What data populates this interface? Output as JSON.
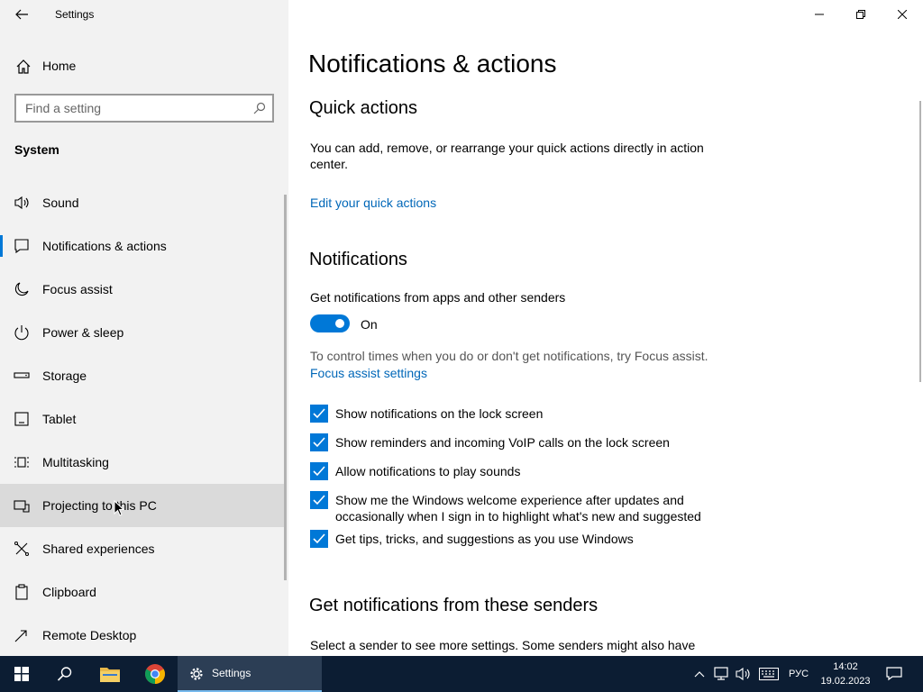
{
  "window": {
    "title": "Settings",
    "controls": [
      "minimize",
      "restore",
      "close"
    ]
  },
  "sidebar": {
    "home_label": "Home",
    "search_placeholder": "Find a setting",
    "section_label": "System",
    "items": [
      {
        "label": "Sound",
        "icon": "speaker-icon",
        "active": false
      },
      {
        "label": "Notifications & actions",
        "icon": "notification-icon",
        "active": true
      },
      {
        "label": "Focus assist",
        "icon": "moon-icon",
        "active": false
      },
      {
        "label": "Power & sleep",
        "icon": "power-icon",
        "active": false
      },
      {
        "label": "Storage",
        "icon": "storage-icon",
        "active": false
      },
      {
        "label": "Tablet",
        "icon": "tablet-icon",
        "active": false
      },
      {
        "label": "Multitasking",
        "icon": "multitasking-icon",
        "active": false
      },
      {
        "label": "Projecting to this PC",
        "icon": "projecting-icon",
        "active": false,
        "hover": true
      },
      {
        "label": "Shared experiences",
        "icon": "shared-icon",
        "active": false
      },
      {
        "label": "Clipboard",
        "icon": "clipboard-icon",
        "active": false
      },
      {
        "label": "Remote Desktop",
        "icon": "remote-desktop-icon",
        "active": false
      }
    ]
  },
  "main": {
    "page_title": "Notifications & actions",
    "quick_actions": {
      "heading": "Quick actions",
      "description": "You can add, remove, or rearrange your quick actions directly in action center.",
      "link": "Edit your quick actions"
    },
    "notifications": {
      "heading": "Notifications",
      "toggle_caption": "Get notifications from apps and other senders",
      "toggle_state": "On",
      "focus_hint": "To control times when you do or don't get notifications, try Focus assist.",
      "focus_link": "Focus assist settings",
      "checkboxes": [
        {
          "label": "Show notifications on the lock screen",
          "checked": true
        },
        {
          "label": "Show reminders and incoming VoIP calls on the lock screen",
          "checked": true
        },
        {
          "label": "Allow notifications to play sounds",
          "checked": true
        },
        {
          "label": "Show me the Windows welcome experience after updates and occasionally when I sign in to highlight what's new and suggested",
          "checked": true
        },
        {
          "label": "Get tips, tricks, and suggestions as you use Windows",
          "checked": true
        }
      ]
    },
    "senders": {
      "heading": "Get notifications from these senders",
      "description": "Select a sender to see more settings. Some senders might also have"
    }
  },
  "taskbar": {
    "active_app": "Settings",
    "language": "РУС",
    "time": "14:02",
    "date": "19.02.2023"
  },
  "colors": {
    "accent": "#0078d7",
    "link": "#0067b8",
    "sidebar_bg": "#f2f2f2",
    "taskbar_bg": "#0c1d33"
  }
}
